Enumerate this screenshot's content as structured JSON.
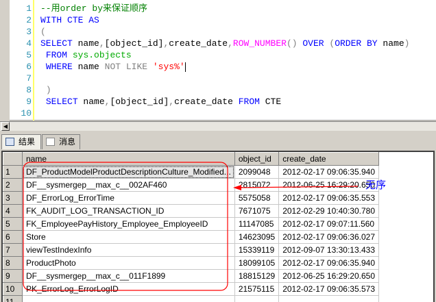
{
  "editor": {
    "lines": [
      {
        "n": "1",
        "parts": [
          [
            "cm",
            "--用order by来保证顺序"
          ]
        ]
      },
      {
        "n": "2",
        "parts": [
          [
            "kw",
            "WITH"
          ],
          [
            "tx",
            " "
          ],
          [
            "kw",
            "CTE"
          ],
          [
            "tx",
            " "
          ],
          [
            "kw",
            "AS"
          ]
        ]
      },
      {
        "n": "3",
        "parts": [
          [
            "gr",
            "("
          ]
        ]
      },
      {
        "n": "4",
        "parts": [
          [
            "kw",
            "SELECT"
          ],
          [
            "tx",
            " name"
          ],
          [
            "gr",
            ","
          ],
          [
            "tx",
            "[object_id]"
          ],
          [
            "gr",
            ","
          ],
          [
            "tx",
            "create_date"
          ],
          [
            "gr",
            ","
          ],
          [
            "fn",
            "ROW_NUMBER"
          ],
          [
            "gr",
            "()"
          ],
          [
            "tx",
            " "
          ],
          [
            "kw",
            "OVER"
          ],
          [
            "tx",
            " "
          ],
          [
            "gr",
            "("
          ],
          [
            "kw",
            "ORDER BY"
          ],
          [
            "tx",
            " name"
          ],
          [
            "gr",
            ")"
          ]
        ]
      },
      {
        "n": "5",
        "parts": [
          [
            "tx",
            " "
          ],
          [
            "kw",
            "FROM"
          ],
          [
            "tx",
            " "
          ],
          [
            "sy",
            "sys.objects"
          ]
        ]
      },
      {
        "n": "6",
        "parts": [
          [
            "tx",
            " "
          ],
          [
            "kw",
            "WHERE"
          ],
          [
            "tx",
            " name "
          ],
          [
            "gr",
            "NOT LIKE"
          ],
          [
            "tx",
            " "
          ],
          [
            "st",
            "'sys%'"
          ]
        ]
      },
      {
        "n": "7",
        "parts": []
      },
      {
        "n": "8",
        "parts": [
          [
            "tx",
            " "
          ],
          [
            "gr",
            ")"
          ]
        ]
      },
      {
        "n": "9",
        "parts": [
          [
            "tx",
            " "
          ],
          [
            "kw",
            "SELECT"
          ],
          [
            "tx",
            " name"
          ],
          [
            "gr",
            ","
          ],
          [
            "tx",
            "[object_id]"
          ],
          [
            "gr",
            ","
          ],
          [
            "tx",
            "create_date "
          ],
          [
            "kw",
            "FROM"
          ],
          [
            "tx",
            " CTE"
          ]
        ]
      },
      {
        "n": "10",
        "parts": []
      }
    ]
  },
  "tabs": {
    "results": "结果",
    "messages": "消息"
  },
  "grid": {
    "columns": [
      "name",
      "object_id",
      "create_date"
    ],
    "rows": [
      [
        "1",
        "DF_ProductModelProductDescriptionCulture_Modified...",
        "2099048",
        "2012-02-17 09:06:35.940"
      ],
      [
        "2",
        "DF__sysmergep__max_c__002AF460",
        "2815072",
        "2012-06-25 16:29:20.650"
      ],
      [
        "3",
        "DF_ErrorLog_ErrorTime",
        "5575058",
        "2012-02-17 09:06:35.553"
      ],
      [
        "4",
        "FK_AUDIT_LOG_TRANSACTION_ID",
        "7671075",
        "2012-02-29 10:40:30.780"
      ],
      [
        "5",
        "FK_EmployeePayHistory_Employee_EmployeeID",
        "11147085",
        "2012-02-17 09:07:11.560"
      ],
      [
        "6",
        "Store",
        "14623095",
        "2012-02-17 09:06:36.027"
      ],
      [
        "7",
        "viewTestIndexInfo",
        "15339119",
        "2012-09-07 13:30:13.433"
      ],
      [
        "8",
        "ProductPhoto",
        "18099105",
        "2012-02-17 09:06:35.940"
      ],
      [
        "9",
        "DF__sysmergep__max_c__011F1899",
        "18815129",
        "2012-06-25 16:29:20.650"
      ],
      [
        "10",
        "PK_ErrorLog_ErrorLogID",
        "21575115",
        "2012-02-17 09:06:35.573"
      ],
      [
        "11",
        "",
        "",
        ""
      ]
    ]
  },
  "annotation": {
    "text": "无序",
    "color": "#ff0000",
    "text_color": "#0000ff"
  }
}
